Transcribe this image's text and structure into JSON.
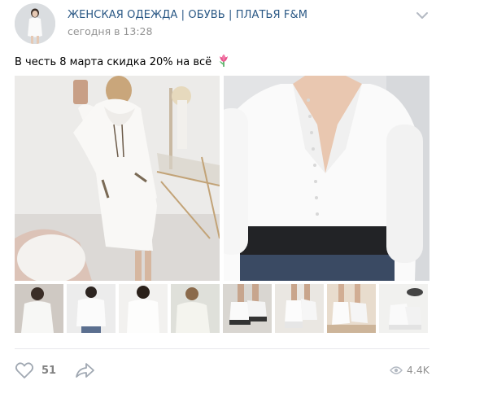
{
  "post": {
    "author": "ЖЕНСКАЯ ОДЕЖДА | ОБУВЬ | ПЛАТЬЯ F&M",
    "date": "сегодня в 13:28",
    "text": "В честь 8 марта скидка 20% на всё",
    "text_emoji_icon": "tulip-icon",
    "likes": "51",
    "views": "4.4K"
  },
  "icons": {
    "menu": "chevron-down-icon",
    "like": "heart-icon",
    "share": "share-arrow-icon",
    "views": "eye-icon"
  },
  "colors": {
    "author_link": "#2a5885",
    "meta_text": "#939393",
    "divider": "#e7e8ec",
    "icon_gray": "#a0a8b2"
  },
  "photos": {
    "main": [
      {
        "subject": "white hooded sweatshirt dress"
      },
      {
        "subject": "white button-front blouse"
      }
    ],
    "thumbnails": [
      {
        "subject": "white blouse"
      },
      {
        "subject": "white lace blouse"
      },
      {
        "subject": "white turtleneck top"
      },
      {
        "subject": "white knit sweater"
      },
      {
        "subject": "white ankle boots"
      },
      {
        "subject": "white platform ankle boots"
      },
      {
        "subject": "white lace-up boots"
      },
      {
        "subject": "white chunky boots"
      }
    ]
  }
}
